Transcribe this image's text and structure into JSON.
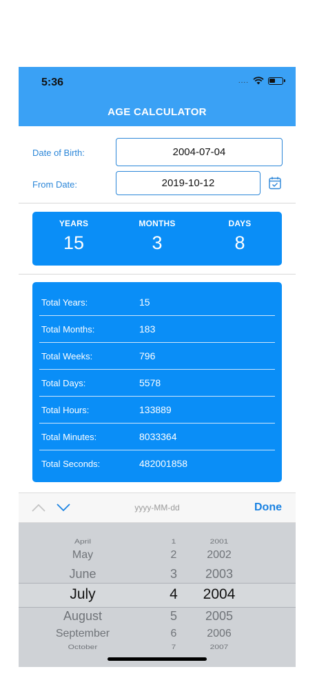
{
  "status": {
    "time": "5:36"
  },
  "nav": {
    "title": "AGE CALCULATOR"
  },
  "form": {
    "dob_label": "Date of Birth:",
    "dob_value": "2004-07-04",
    "from_label": "From Date:",
    "from_value": "2019-10-12"
  },
  "summary": {
    "years_label": "YEARS",
    "years": "15",
    "months_label": "MONTHS",
    "months": "3",
    "days_label": "DAYS",
    "days": "8"
  },
  "totals": [
    {
      "label": "Total Years:",
      "value": "15"
    },
    {
      "label": "Total Months:",
      "value": "183"
    },
    {
      "label": "Total Weeks:",
      "value": "796"
    },
    {
      "label": "Total Days:",
      "value": "5578"
    },
    {
      "label": "Total Hours:",
      "value": "133889"
    },
    {
      "label": "Total Minutes:",
      "value": "8033364"
    },
    {
      "label": "Total Seconds:",
      "value": "482001858"
    }
  ],
  "toolbar": {
    "format": "yyyy-MM-dd",
    "done_label": "Done"
  },
  "picker": {
    "months": [
      "April",
      "May",
      "June",
      "July",
      "August",
      "September",
      "October"
    ],
    "days": [
      "1",
      "2",
      "3",
      "4",
      "5",
      "6",
      "7"
    ],
    "years": [
      "2001",
      "2002",
      "2003",
      "2004",
      "2005",
      "2006",
      "2007"
    ],
    "selected_index": 3
  },
  "colors": {
    "primary": "#0a8ef7",
    "nav": "#3aa1f5",
    "accent_text": "#2b86d8"
  },
  "icons": {
    "calendar": "calendar-check-icon",
    "prev": "chevron-up-icon",
    "next": "chevron-down-icon"
  }
}
